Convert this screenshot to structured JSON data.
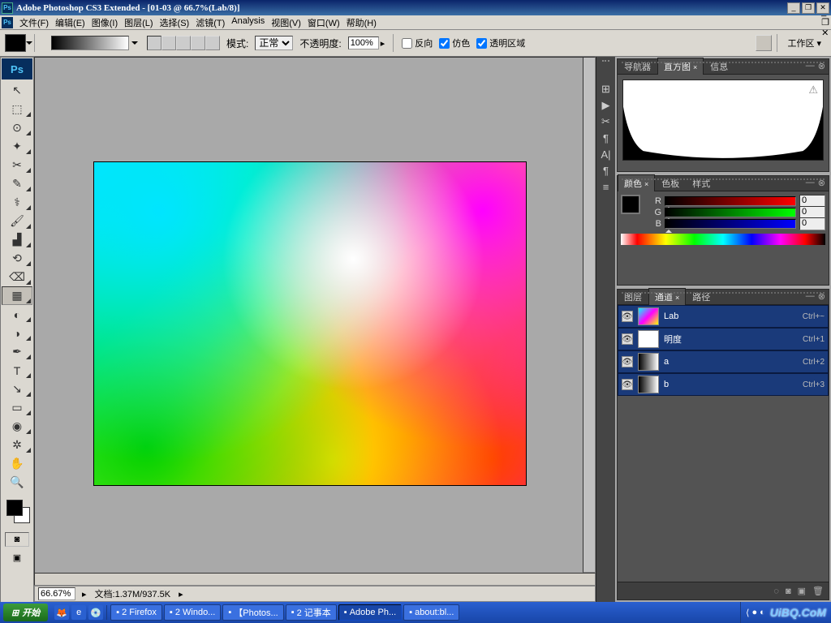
{
  "title": "Adobe Photoshop CS3 Extended - [01-03 @ 66.7%(Lab/8)]",
  "menu": [
    "文件(F)",
    "编辑(E)",
    "图像(I)",
    "图层(L)",
    "选择(S)",
    "滤镜(T)",
    "Analysis",
    "视图(V)",
    "窗口(W)",
    "帮助(H)"
  ],
  "opt": {
    "mode_label": "模式:",
    "mode_value": "正常",
    "opacity_label": "不透明度:",
    "opacity_value": "100%",
    "ck1": "反向",
    "ck2": "仿色",
    "ck3": "透明区域",
    "workspace": "工作区"
  },
  "canvas": {
    "zoom": "66.67%",
    "doc": "文档:1.37M/937.5K"
  },
  "panel_nav": {
    "tabs": [
      "导航器",
      "直方图",
      "信息"
    ],
    "active": 1
  },
  "panel_color": {
    "tabs": [
      "颜色",
      "色板",
      "样式"
    ],
    "active": 0,
    "channels": [
      {
        "l": "R",
        "v": "0"
      },
      {
        "l": "G",
        "v": "0"
      },
      {
        "l": "B",
        "v": "0"
      }
    ]
  },
  "panel_ch": {
    "tabs": [
      "图层",
      "通道",
      "路径"
    ],
    "active": 1,
    "rows": [
      {
        "name": "Lab",
        "sc": "Ctrl+~",
        "thumb": "lab"
      },
      {
        "name": "明度",
        "sc": "Ctrl+1",
        "thumb": "l"
      },
      {
        "name": "a",
        "sc": "Ctrl+2",
        "thumb": "a"
      },
      {
        "name": "b",
        "sc": "Ctrl+3",
        "thumb": "b"
      }
    ]
  },
  "taskbar": {
    "start": "开始",
    "tasks": [
      "2 Firefox",
      "2 Windo...",
      "【Photos...",
      "2 记事本",
      "Adobe Ph...",
      "about:bl..."
    ],
    "logo": "UiBQ.CoM"
  },
  "tools": [
    {
      "g": "↖",
      "n": "move-tool"
    },
    {
      "g": "⬚",
      "n": "marquee-tool",
      "t": 1
    },
    {
      "g": "⊙",
      "n": "lasso-tool",
      "t": 1
    },
    {
      "g": "✦",
      "n": "magic-wand-tool",
      "t": 1
    },
    {
      "g": "✂",
      "n": "crop-tool",
      "t": 1
    },
    {
      "g": "✎",
      "n": "slice-tool",
      "t": 1
    },
    {
      "g": "⚕",
      "n": "healing-tool",
      "t": 1
    },
    {
      "g": "🖌",
      "n": "brush-tool",
      "t": 1
    },
    {
      "g": "▟",
      "n": "stamp-tool",
      "t": 1
    },
    {
      "g": "⟲",
      "n": "history-brush-tool",
      "t": 1
    },
    {
      "g": "⌫",
      "n": "eraser-tool",
      "t": 1
    },
    {
      "g": "▦",
      "n": "gradient-tool",
      "t": 1,
      "sel": 1
    },
    {
      "g": "◐",
      "n": "blur-tool",
      "t": 1
    },
    {
      "g": "◑",
      "n": "dodge-tool",
      "t": 1
    },
    {
      "g": "✒",
      "n": "pen-tool",
      "t": 1
    },
    {
      "g": "T",
      "n": "type-tool",
      "t": 1
    },
    {
      "g": "↘",
      "n": "path-select-tool",
      "t": 1
    },
    {
      "g": "▭",
      "n": "shape-tool",
      "t": 1
    },
    {
      "g": "◉",
      "n": "notes-tool",
      "t": 1
    },
    {
      "g": "✲",
      "n": "eyedropper-tool",
      "t": 1
    },
    {
      "g": "✋",
      "n": "hand-tool"
    },
    {
      "g": "🔍",
      "n": "zoom-tool"
    }
  ],
  "strip": [
    "⊞",
    "▶",
    "✂",
    "¶",
    "A|",
    "¶",
    "≡"
  ]
}
